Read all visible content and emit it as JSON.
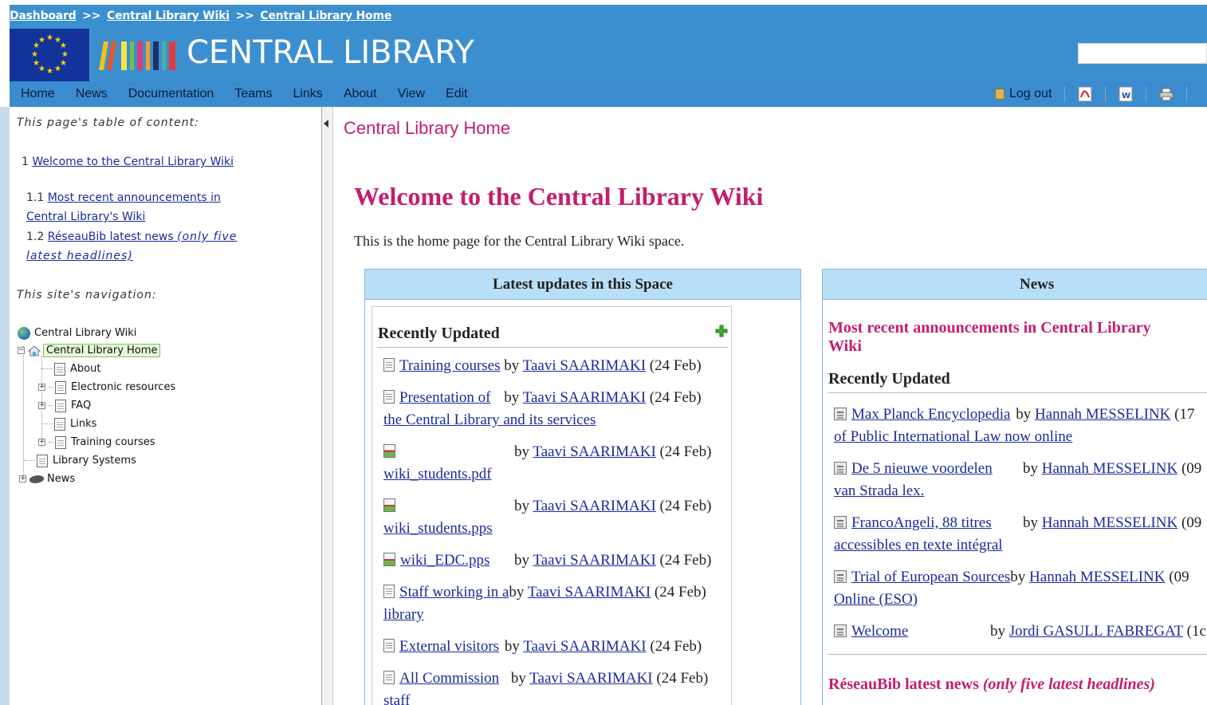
{
  "breadcrumb": {
    "items": [
      "Dashboard",
      "Central Library Wiki",
      "Central Library Home"
    ],
    "separator": ">>"
  },
  "brand": {
    "logo_text": "CENTRAL LIBRARY"
  },
  "search": {
    "value": ""
  },
  "nav": {
    "items": [
      "Home",
      "News",
      "Documentation",
      "Teams",
      "Links",
      "About",
      "View",
      "Edit"
    ],
    "logout_label": "Log out",
    "tools": [
      "pdf-export-icon",
      "word-export-icon",
      "print-icon"
    ]
  },
  "sidebar": {
    "toc_caption": "This page's table of content:",
    "toc": [
      {
        "num": "1",
        "text": "Welcome to the Central Library Wiki",
        "text2": ""
      },
      {
        "num": "1.1",
        "text": "Most recent announcements in",
        "text2": "Central Library's Wiki"
      },
      {
        "num": "1.2",
        "text": "RéseauBib latest news ",
        "italic": "(only five",
        "text2": "latest headlines)"
      }
    ],
    "nav_caption": "This site's navigation:",
    "tree": {
      "root": "Central Library Wiki",
      "home": "Central Library Home",
      "children": [
        "About",
        "Electronic resources",
        "FAQ",
        "Links",
        "Training courses"
      ],
      "library_systems": "Library Systems",
      "news": "News"
    }
  },
  "main": {
    "page_title": "Central Library Home",
    "welcome": "Welcome to the Central Library Wiki",
    "intro": "This is the home page for the Central Library Wiki space."
  },
  "updates_panel": {
    "header": "Latest updates in this Space",
    "recent_title": "Recently Updated",
    "items": [
      {
        "title": "Training courses",
        "title2": "",
        "author": "Taavi SAARIMAKI",
        "date": "(24 Feb)",
        "icon": "page-icon"
      },
      {
        "title": "Presentation of",
        "title2": "the Central Library and its services",
        "author": "Taavi SAARIMAKI",
        "date": "(24 Feb)",
        "icon": "page-icon"
      },
      {
        "title": "",
        "title2": "wiki_students.pdf",
        "author": "Taavi SAARIMAKI",
        "date": "(24 Feb)",
        "icon": "attachment-icon"
      },
      {
        "title": "",
        "title2": "wiki_students.pps",
        "author": "Taavi SAARIMAKI",
        "date": "(24 Feb)",
        "icon": "attachment-icon"
      },
      {
        "title": "wiki_EDC.pps",
        "title2": "",
        "author": "Taavi SAARIMAKI",
        "date": "(24 Feb)",
        "icon": "attachment-icon"
      },
      {
        "title": "Staff working in a",
        "title2": "library",
        "author": "Taavi SAARIMAKI",
        "date": "(24 Feb)",
        "icon": "page-icon"
      },
      {
        "title": "External visitors",
        "title2": "",
        "author": "Taavi SAARIMAKI",
        "date": "(24 Feb)",
        "icon": "page-icon"
      },
      {
        "title": "All Commission",
        "title2": "staff",
        "author": "Taavi SAARIMAKI",
        "date": "(24 Feb)",
        "icon": "page-icon"
      }
    ]
  },
  "news_panel": {
    "header": "News",
    "heading": "Most recent announcements in Central Library\nWiki",
    "recent_title": "Recently Updated",
    "items": [
      {
        "title": "Max Planck Encyclopedia",
        "title2": "of Public International Law now online",
        "author": "Hannah MESSELINK",
        "date": "(17"
      },
      {
        "title": "De 5 nieuwe voordelen",
        "title2": "van Strada lex.",
        "author": "Hannah MESSELINK",
        "date": "(09"
      },
      {
        "title": "FrancoAngeli, 88 titres",
        "title2": "accessibles en texte intégral",
        "author": "Hannah MESSELINK",
        "date": "(09"
      },
      {
        "title": "Trial of European Sources",
        "title2": "Online (ESO)",
        "author": "Hannah MESSELINK",
        "date": "(09"
      },
      {
        "title": "Welcome",
        "title2": "",
        "author": "Jordi GASULL FABREGAT",
        "date": "(1c"
      }
    ],
    "reseau_heading": "RéseauBib latest news ",
    "reseau_italic": "(only five latest headlines)"
  },
  "by_label": "by"
}
